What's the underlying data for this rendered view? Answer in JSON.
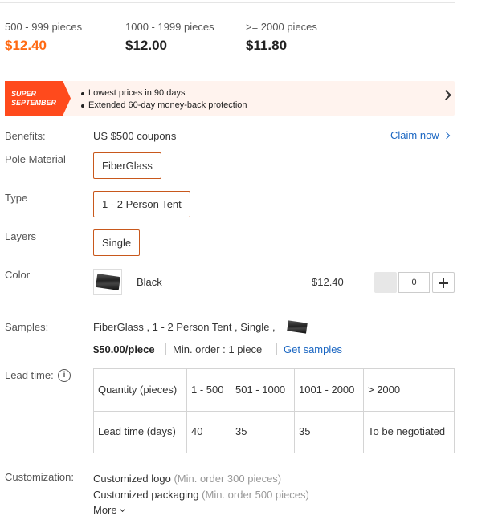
{
  "tiers": [
    {
      "qty": "500 - 999 pieces",
      "price": "$12.40"
    },
    {
      "qty": "1000 - 1999 pieces",
      "price": "$12.00"
    },
    {
      "qty": ">= 2000 pieces",
      "price": "$11.80"
    }
  ],
  "colors": {
    "accent": "#ff6a14",
    "link": "#1a66c2",
    "banner_bg": "#fff3ee",
    "badge": "#ff4a1c",
    "option_border": "#c8581c"
  },
  "banner": {
    "badge_line1": "SUPER",
    "badge_line2": "SEPTEMBER",
    "points": [
      "Lowest prices in 90 days",
      "Extended 60-day money-back protection"
    ],
    "icon": "chevron-right-icon"
  },
  "benefits": {
    "label": "Benefits:",
    "value": "US $500 coupons",
    "action": "Claim now"
  },
  "pole_material": {
    "label": "Pole Material",
    "option": "FiberGlass"
  },
  "type": {
    "label": "Type",
    "option": "1 - 2 Person Tent"
  },
  "layers": {
    "label": "Layers",
    "option": "Single"
  },
  "color": {
    "label": "Color",
    "name": "Black",
    "price": "$12.40",
    "quantity": "0"
  },
  "samples": {
    "label": "Samples:",
    "spec": "FiberGlass , 1 - 2 Person Tent , Single ,",
    "price": "$50.00/piece",
    "min_order": "Min. order : 1 piece",
    "action": "Get samples"
  },
  "lead_time": {
    "label": "Lead time:",
    "info_icon": "i",
    "headers": [
      "Quantity (pieces)",
      "1 - 500",
      "501 - 1000",
      "1001 - 2000",
      "> 2000"
    ],
    "row": [
      "Lead time (days)",
      "40",
      "35",
      "35",
      "To be negotiated"
    ]
  },
  "customization": {
    "label": "Customization:",
    "items": [
      {
        "name": "Customized logo",
        "note": "(Min. order 300 pieces)"
      },
      {
        "name": "Customized packaging",
        "note": "(Min. order 500 pieces)"
      }
    ],
    "more": "More"
  }
}
